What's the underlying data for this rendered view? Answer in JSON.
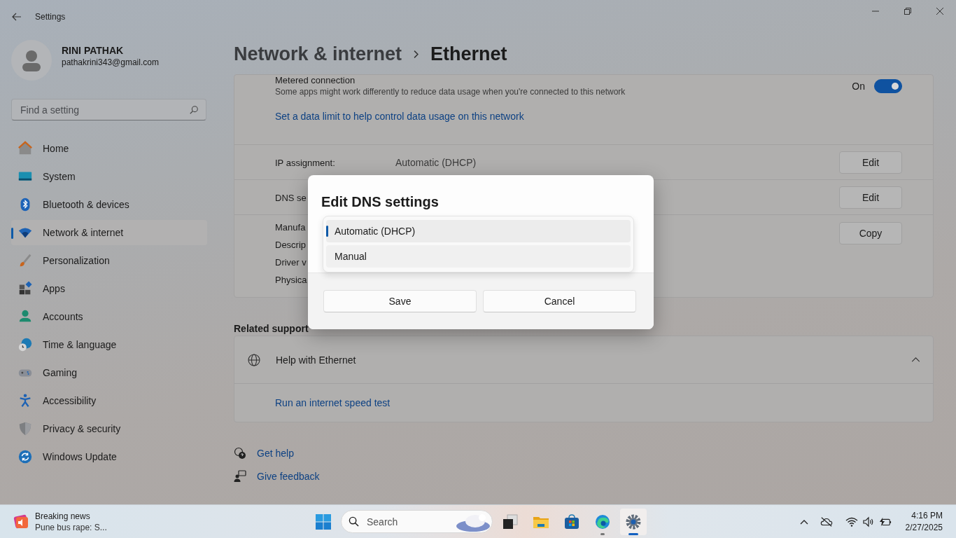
{
  "window": {
    "title": "Settings"
  },
  "profile": {
    "name": "RINI PATHAK",
    "email": "pathakrini343@gmail.com"
  },
  "search": {
    "placeholder": "Find a setting"
  },
  "nav": [
    {
      "label": "Home",
      "kind": "home",
      "selected": false
    },
    {
      "label": "System",
      "kind": "system",
      "selected": false
    },
    {
      "label": "Bluetooth & devices",
      "kind": "bluetooth",
      "selected": false
    },
    {
      "label": "Network & internet",
      "kind": "network",
      "selected": true
    },
    {
      "label": "Personalization",
      "kind": "personalization",
      "selected": false
    },
    {
      "label": "Apps",
      "kind": "apps",
      "selected": false
    },
    {
      "label": "Accounts",
      "kind": "accounts",
      "selected": false
    },
    {
      "label": "Time & language",
      "kind": "time",
      "selected": false
    },
    {
      "label": "Gaming",
      "kind": "gaming",
      "selected": false
    },
    {
      "label": "Accessibility",
      "kind": "accessibility",
      "selected": false
    },
    {
      "label": "Privacy & security",
      "kind": "privacy",
      "selected": false
    },
    {
      "label": "Windows Update",
      "kind": "update",
      "selected": false
    }
  ],
  "breadcrumb": {
    "parent": "Network & internet",
    "current": "Ethernet"
  },
  "metered": {
    "title": "Metered connection",
    "description": "Some apps might work differently to reduce data usage when you're connected to this network",
    "state": "On",
    "on": true,
    "link": "Set a data limit to help control data usage on this network"
  },
  "properties": [
    {
      "label": "IP assignment:",
      "value": "Automatic (DHCP)",
      "button": "Edit"
    },
    {
      "label": "DNS se",
      "button": "Edit"
    }
  ],
  "details": {
    "labels": [
      "Manufa",
      "Descrip",
      "Driver v",
      "Physica"
    ],
    "button": "Copy"
  },
  "related_support": {
    "title": "Related support",
    "heading": "Help with Ethernet",
    "expanded": true,
    "links": [
      "Run an internet speed test"
    ]
  },
  "footer_links": [
    {
      "label": "Get help",
      "kind": "help"
    },
    {
      "label": "Give feedback",
      "kind": "feedback"
    }
  ],
  "dialog": {
    "title": "Edit DNS settings",
    "options": [
      {
        "label": "Automatic (DHCP)",
        "selected": true
      },
      {
        "label": "Manual",
        "selected": false
      }
    ],
    "buttons": [
      "Save",
      "Cancel"
    ]
  },
  "taskbar": {
    "news": {
      "title": "Breaking news",
      "headline": "Pune bus rape: S..."
    },
    "search_placeholder": "Search",
    "apps": [
      {
        "kind": "taskview",
        "running": false,
        "selected": false
      },
      {
        "kind": "explorer",
        "running": false,
        "selected": false
      },
      {
        "kind": "store",
        "running": false,
        "selected": false
      },
      {
        "kind": "edge",
        "running": true,
        "selected": false
      },
      {
        "kind": "settings",
        "running": true,
        "selected": true
      }
    ],
    "clock": {
      "time": "4:16 PM",
      "date": "2/27/2025"
    }
  }
}
